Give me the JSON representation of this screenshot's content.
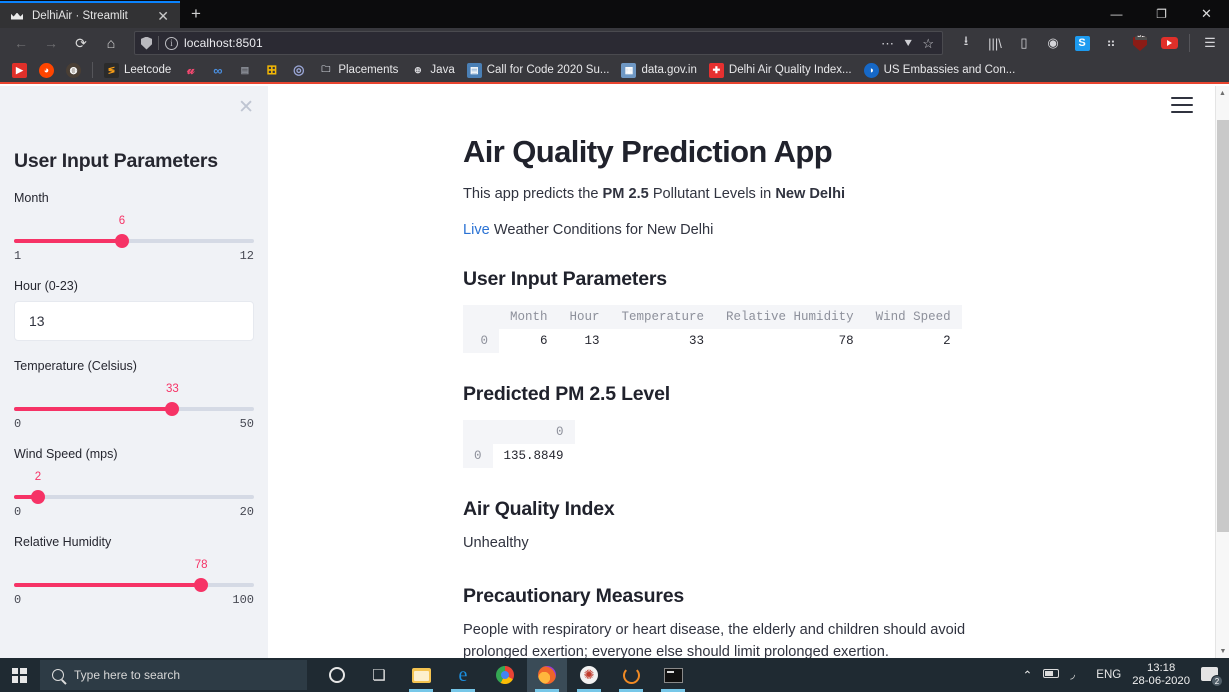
{
  "browser": {
    "tab": {
      "title": "DelhiAir · Streamlit",
      "favicon": "streamlit-icon",
      "close": "✕"
    },
    "new_tab_label": "+",
    "window_controls": {
      "minimize": "—",
      "maximize": "❐",
      "close": "✕"
    },
    "nav": {
      "back": "←",
      "forward": "→",
      "reload": "⟳",
      "home": "⌂"
    },
    "url": {
      "value": "localhost:8501",
      "placeholder": "Search with Google or enter address"
    },
    "url_actions": {
      "more": "⋯",
      "pocket": "⯆",
      "bookmark": "☆"
    },
    "toolbar_right": [
      {
        "name": "downloads-icon",
        "glyph": "⭳"
      },
      {
        "name": "library-icon",
        "glyph": "|||\\"
      },
      {
        "name": "sidebar-icon",
        "glyph": "▯"
      },
      {
        "name": "account-icon",
        "glyph": "◉"
      },
      {
        "name": "extension-s-icon",
        "glyph": "S"
      },
      {
        "name": "apps-grid-icon",
        "glyph": "⠶"
      },
      {
        "name": "ublock-origin-icon",
        "badge": "324"
      },
      {
        "name": "youtube-extension-icon",
        "glyph": "▶"
      },
      {
        "name": "menu-icon",
        "glyph": "☰"
      }
    ],
    "bookmarks": [
      {
        "label": "",
        "icon": "youtube-icon",
        "color": "#e0302a",
        "glyph": "▶"
      },
      {
        "label": "",
        "icon": "reddit-icon",
        "color": "#ff4500",
        "glyph": "◕"
      },
      {
        "label": "",
        "icon": "circle-icon",
        "color": "#4a3f35",
        "glyph": "◍"
      },
      {
        "label": "Leetcode",
        "icon": "leetcode-icon",
        "color": "#2b2b2b",
        "glyph": "≶"
      },
      {
        "label": "",
        "icon": "u-icon",
        "color": "#38383d",
        "glyph": "𝓊"
      },
      {
        "label": "",
        "icon": "colab-icon",
        "color": "#38383d",
        "glyph": "∞"
      },
      {
        "label": "",
        "icon": "document-icon",
        "color": "#38383d",
        "glyph": "▤"
      },
      {
        "label": "",
        "icon": "microsoft-icon",
        "color": "#38383d",
        "glyph": "⊞"
      },
      {
        "label": "",
        "icon": "target-icon",
        "color": "#38383d",
        "glyph": "◎"
      },
      {
        "label": "Placements",
        "icon": "folder-icon",
        "color": "#38383d",
        "glyph": "🗀"
      },
      {
        "label": "Java",
        "icon": "globe-icon",
        "color": "#38383d",
        "glyph": "⊕"
      },
      {
        "label": "Call for Code 2020 Su...",
        "icon": "page-icon",
        "color": "#4a7fb5",
        "glyph": "▤"
      },
      {
        "label": "data.gov.in",
        "icon": "datagov-icon",
        "color": "#6f98c4",
        "glyph": "▦"
      },
      {
        "label": "Delhi Air Quality Index...",
        "icon": "plus-red-icon",
        "color": "#e63030",
        "glyph": "✚"
      },
      {
        "label": "US Embassies and Con...",
        "icon": "embassy-icon",
        "color": "#1668c7",
        "glyph": "◑"
      }
    ]
  },
  "sidebar": {
    "close_label": "✕",
    "title": "User Input Parameters",
    "widgets": [
      {
        "type": "slider",
        "name": "month",
        "label": "Month",
        "value": "6",
        "min": "1",
        "max": "12",
        "percent": 45
      },
      {
        "type": "number",
        "name": "hour",
        "label": "Hour (0-23)",
        "value": "13"
      },
      {
        "type": "slider",
        "name": "temperature",
        "label": "Temperature (Celsius)",
        "value": "33",
        "min": "0",
        "max": "50",
        "percent": 66
      },
      {
        "type": "slider",
        "name": "wind-speed",
        "label": "Wind Speed (mps)",
        "value": "2",
        "min": "0",
        "max": "20",
        "percent": 10
      },
      {
        "type": "slider",
        "name": "relative-humidity",
        "label": "Relative Humidity",
        "value": "78",
        "min": "0",
        "max": "100",
        "percent": 78
      }
    ]
  },
  "app": {
    "menu_label": "☰",
    "title": "Air Quality Prediction App",
    "lede": {
      "pre": "This app predicts the ",
      "bold1": "PM 2.5",
      "mid": " Pollutant Levels in ",
      "bold2": "New Delhi"
    },
    "live": {
      "link": "Live",
      "rest": " Weather Conditions for New Delhi"
    },
    "sections": {
      "inputs_heading": "User Input Parameters",
      "prediction_heading": "Predicted PM 2.5 Level",
      "aqi_heading": "Air Quality Index",
      "aqi_value": "Unhealthy",
      "precautions_heading": "Precautionary Measures",
      "precautions_text": "People with respiratory or heart disease, the elderly and children should avoid prolonged exertion; everyone else should limit prolonged exertion."
    },
    "input_table": {
      "index_header": "",
      "columns": [
        "Month",
        "Hour",
        "Temperature",
        "Relative Humidity",
        "Wind Speed"
      ],
      "rows": [
        {
          "index": "0",
          "values": [
            "6",
            "13",
            "33",
            "78",
            "2"
          ]
        }
      ]
    },
    "prediction_table": {
      "columns": [
        "0"
      ],
      "rows": [
        {
          "index": "0",
          "values": [
            "135.8849"
          ]
        }
      ]
    },
    "accent_color": "#f63366",
    "link_color": "#2a72d4"
  },
  "taskbar": {
    "search_placeholder": "Type here to search",
    "apps": [
      {
        "name": "cortana-icon",
        "glyph": "◯",
        "state": ""
      },
      {
        "name": "task-view-icon",
        "glyph": "❏",
        "state": ""
      },
      {
        "name": "file-explorer-icon",
        "glyph": "🗀",
        "state": "running"
      },
      {
        "name": "edge-icon",
        "glyph": "e",
        "state": "running"
      },
      {
        "name": "chrome-icon",
        "glyph": "◉",
        "state": ""
      },
      {
        "name": "firefox-icon",
        "glyph": "◐",
        "state": "active"
      },
      {
        "name": "spyder-icon",
        "glyph": "✺",
        "state": "running"
      },
      {
        "name": "anaconda-icon",
        "glyph": "◡",
        "state": "running"
      },
      {
        "name": "terminal-icon",
        "glyph": "▮",
        "state": "running"
      }
    ],
    "tray": {
      "chevron": "⌃",
      "battery": "▭",
      "wifi": "📶",
      "language": "ENG",
      "time": "13:18",
      "date": "28-06-2020",
      "notification_count": "2"
    }
  }
}
